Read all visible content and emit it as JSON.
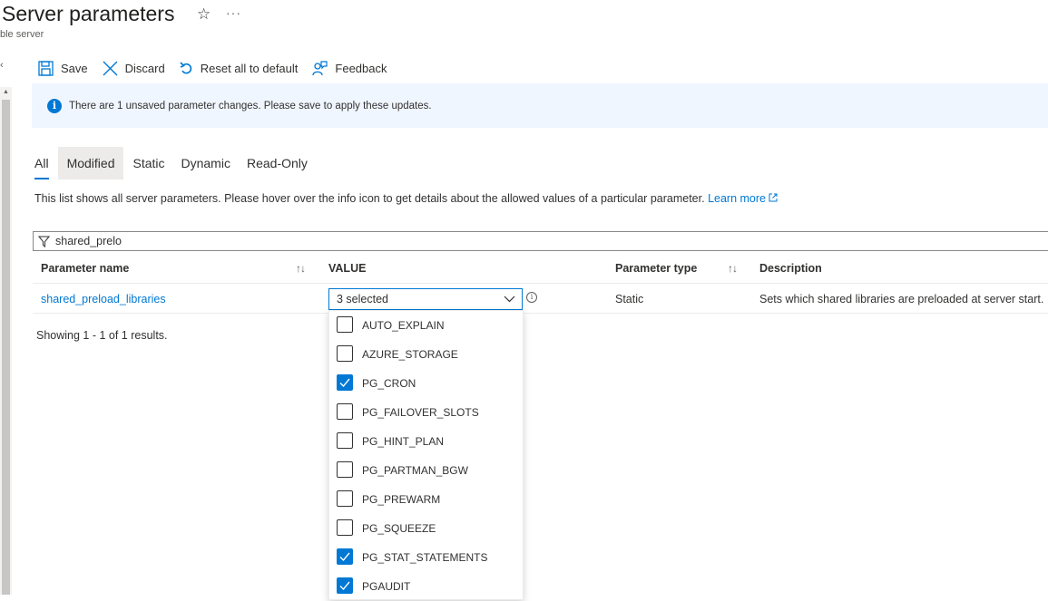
{
  "page": {
    "title": "Server parameters",
    "subtitle": "ble server",
    "star_icon": "star-icon",
    "more_icon": "ellipsis-icon"
  },
  "toolbar": {
    "save_label": "Save",
    "discard_label": "Discard",
    "reset_label": "Reset all to default",
    "feedback_label": "Feedback"
  },
  "infobar": {
    "message": "There are 1 unsaved parameter changes.  Please save to apply these updates.",
    "icon": "info-icon"
  },
  "tabs": [
    {
      "label": "All"
    },
    {
      "label": "Modified"
    },
    {
      "label": "Static"
    },
    {
      "label": "Dynamic"
    },
    {
      "label": "Read-Only"
    }
  ],
  "description": {
    "text": "This list shows all server parameters. Please hover over the info icon to get details about the allowed values of a particular parameter.",
    "link": "Learn more"
  },
  "filter": {
    "value": "shared_prelo"
  },
  "table": {
    "headers": {
      "name": "Parameter name",
      "value": "VALUE",
      "type": "Parameter type",
      "description": "Description"
    },
    "rows": [
      {
        "name": "shared_preload_libraries",
        "value": "3 selected",
        "type": "Static",
        "description": "Sets which shared libraries are preloaded at server start."
      }
    ],
    "footer": "Showing 1 - 1 of 1 results."
  },
  "dropdown": {
    "options": [
      {
        "label": "AUTO_EXPLAIN",
        "checked": false
      },
      {
        "label": "AZURE_STORAGE",
        "checked": false
      },
      {
        "label": "PG_CRON",
        "checked": true
      },
      {
        "label": "PG_FAILOVER_SLOTS",
        "checked": false
      },
      {
        "label": "PG_HINT_PLAN",
        "checked": false
      },
      {
        "label": "PG_PARTMAN_BGW",
        "checked": false
      },
      {
        "label": "PG_PREWARM",
        "checked": false
      },
      {
        "label": "PG_SQUEEZE",
        "checked": false
      },
      {
        "label": "PG_STAT_STATEMENTS",
        "checked": true
      },
      {
        "label": "PGAUDIT",
        "checked": true
      }
    ]
  },
  "colors": {
    "accent": "#0078d4",
    "info_background": "#f0f6ff"
  }
}
